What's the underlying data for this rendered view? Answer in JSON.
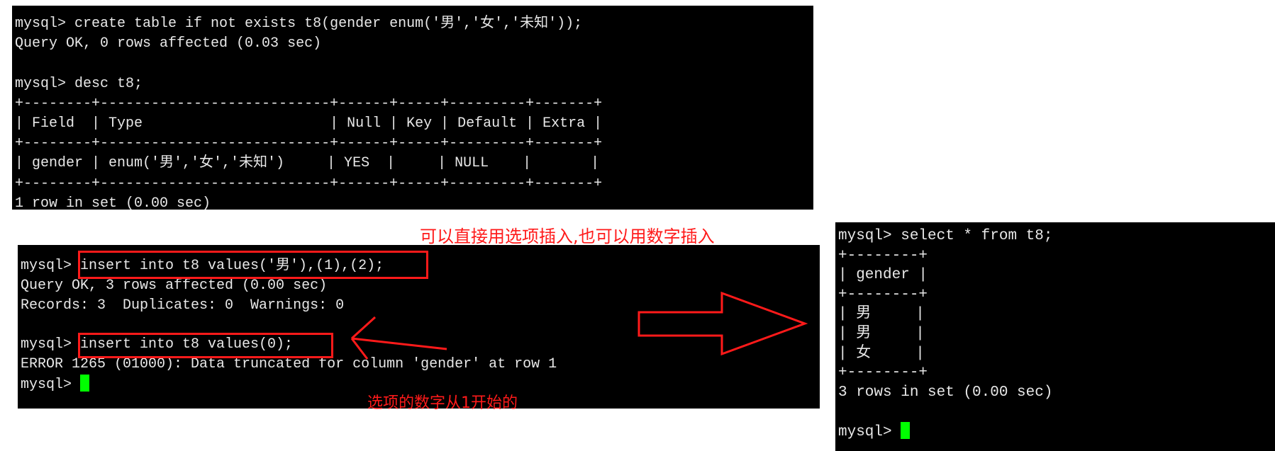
{
  "terminal_top": {
    "lines": [
      "mysql> create table if not exists t8(gender enum('男','女','未知'));",
      "Query OK, 0 rows affected (0.03 sec)",
      "",
      "mysql> desc t8;",
      "+--------+---------------------------+------+-----+---------+-------+",
      "| Field  | Type                      | Null | Key | Default | Extra |",
      "+--------+---------------------------+------+-----+---------+-------+",
      "| gender | enum('男','女','未知')     | YES  |     | NULL    |       |",
      "+--------+---------------------------+------+-----+---------+-------+",
      "1 row in set (0.00 sec)"
    ]
  },
  "terminal_insert": {
    "prompt": "mysql> ",
    "lines": [
      "mysql> insert into t8 values('男'),(1),(2);",
      "Query OK, 3 rows affected (0.00 sec)",
      "Records: 3  Duplicates: 0  Warnings: 0",
      "",
      "mysql> insert into t8 values(0);",
      "ERROR 1265 (01000): Data truncated for column 'gender' at row 1"
    ]
  },
  "terminal_select": {
    "prompt": "mysql> ",
    "lines": [
      "mysql> select * from t8;",
      "+--------+",
      "| gender |",
      "+--------+",
      "| 男     |",
      "| 男     |",
      "| 女     |",
      "+--------+",
      "3 rows in set (0.00 sec)",
      ""
    ]
  },
  "annotations": {
    "note_top": "可以直接用选项插入,也可以用数字插入",
    "note_bottom": "选项的数字从1开始的",
    "annotation_color": "#ff1a1a",
    "cursor_color": "#00ff00"
  }
}
